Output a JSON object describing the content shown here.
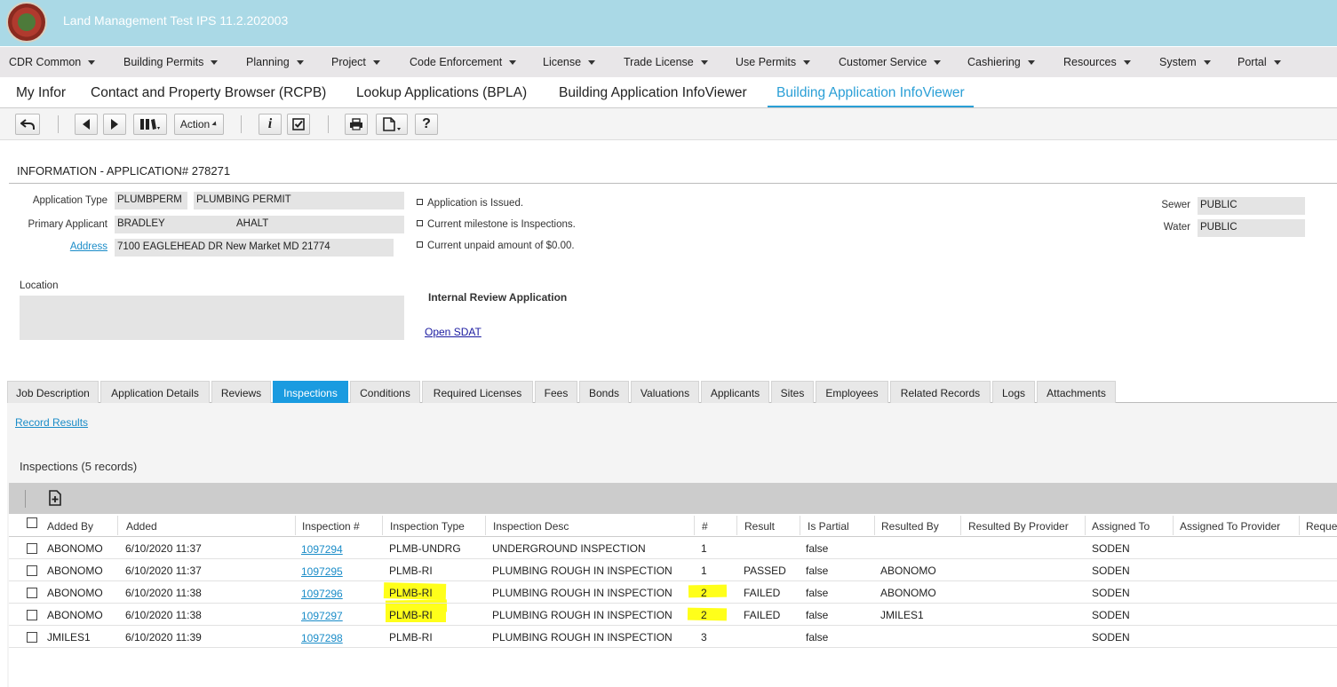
{
  "header": {
    "app_title": "Land Management Test IPS 11.2.202003"
  },
  "menubar": [
    "CDR Common",
    "Building Permits",
    "Planning",
    "Project",
    "Code Enforcement",
    "License",
    "Trade License",
    "Use Permits",
    "Customer Service",
    "Cashiering",
    "Resources",
    "System",
    "Portal"
  ],
  "page_tabs": [
    "My Infor",
    "Contact and Property Browser (RCPB)",
    "Lookup Applications (BPLA)",
    "Building Application InfoViewer",
    "Building Application InfoViewer"
  ],
  "toolbar": {
    "action_label": "Action"
  },
  "info": {
    "title": "INFORMATION - APPLICATION# 278271",
    "application_type_label": "Application Type",
    "application_type_code": "PLUMBPERM",
    "application_type_desc": "PLUMBING PERMIT",
    "primary_applicant_label": "Primary Applicant",
    "applicant_first": "BRADLEY",
    "applicant_last": "AHALT",
    "address_label": "Address",
    "address_value": "7100 EAGLEHEAD DR New Market MD 21774",
    "location_label": "Location",
    "status_bullets": [
      "Application is Issued.",
      "Current milestone is Inspections.",
      "Current unpaid amount of $0.00."
    ],
    "internal_review": "Internal Review Application",
    "open_sdat": "Open SDAT",
    "sewer_label": "Sewer",
    "sewer_value": "PUBLIC",
    "water_label": "Water",
    "water_value": "PUBLIC"
  },
  "detail_tabs": [
    "Job Description",
    "Application Details",
    "Reviews",
    "Inspections",
    "Conditions",
    "Required Licenses",
    "Fees",
    "Bonds",
    "Valuations",
    "Applicants",
    "Sites",
    "Employees",
    "Related Records",
    "Logs",
    "Attachments"
  ],
  "record_results": "Record Results",
  "inspections": {
    "title": "Inspections (5 records)",
    "columns": [
      "Added By",
      "Added",
      "Inspection #",
      "Inspection Type",
      "Inspection Desc",
      "#",
      "Result",
      "Is Partial",
      "Resulted By",
      "Resulted By Provider",
      "Assigned To",
      "Assigned To Provider",
      "Reque"
    ],
    "rows": [
      {
        "added_by": "ABONOMO",
        "added": "6/10/2020 11:37",
        "num": "1097294",
        "type": "PLMB-UNDRG",
        "desc": "UNDERGROUND INSPECTION",
        "count": "1",
        "result": "",
        "partial": "false",
        "resulted_by": "",
        "assigned_to": "SODEN"
      },
      {
        "added_by": "ABONOMO",
        "added": "6/10/2020 11:37",
        "num": "1097295",
        "type": "PLMB-RI",
        "desc": "PLUMBING ROUGH IN INSPECTION",
        "count": "1",
        "result": "PASSED",
        "partial": "false",
        "resulted_by": "ABONOMO",
        "assigned_to": "SODEN"
      },
      {
        "added_by": "ABONOMO",
        "added": "6/10/2020 11:38",
        "num": "1097296",
        "type": "PLMB-RI",
        "desc": "PLUMBING ROUGH IN INSPECTION",
        "count": "2",
        "result": "FAILED",
        "partial": "false",
        "resulted_by": "ABONOMO",
        "assigned_to": "SODEN"
      },
      {
        "added_by": "ABONOMO",
        "added": "6/10/2020 11:38",
        "num": "1097297",
        "type": "PLMB-RI",
        "desc": "PLUMBING ROUGH IN INSPECTION",
        "count": "2",
        "result": "FAILED",
        "partial": "false",
        "resulted_by": "JMILES1",
        "assigned_to": "SODEN"
      },
      {
        "added_by": "JMILES1",
        "added": "6/10/2020 11:39",
        "num": "1097298",
        "type": "PLMB-RI",
        "desc": "PLUMBING ROUGH IN INSPECTION",
        "count": "3",
        "result": "",
        "partial": "false",
        "resulted_by": "",
        "assigned_to": "SODEN"
      }
    ]
  },
  "colors": {
    "header_bg": "#aad9e6",
    "accent": "#1a9be0",
    "highlight": "#ffff1a"
  }
}
